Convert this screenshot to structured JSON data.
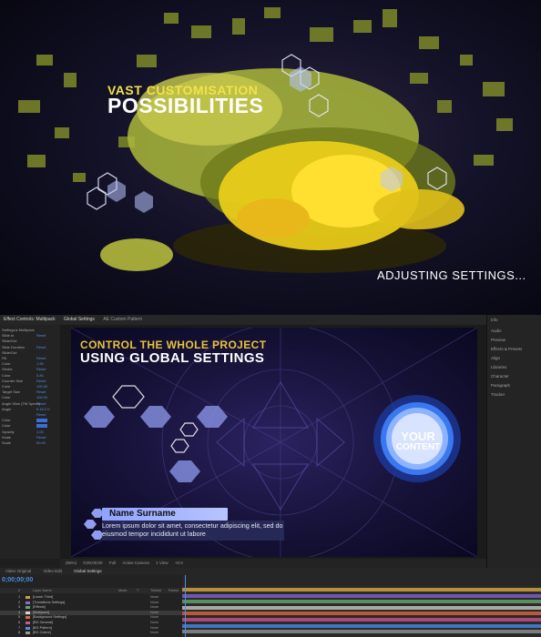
{
  "promo": {
    "line1": "VAST CUSTOMISATION",
    "line2": "POSSIBILITIES",
    "subtitle": "ADJUSTING SETTINGS..."
  },
  "effects_panel": {
    "tab": "Effect Controls: Multipack",
    "rows": [
      {
        "label": "Settings ▸ Multipack",
        "value": ""
      },
      {
        "label": "Slide In",
        "value": "Reset"
      },
      {
        "label": "Slide/Out",
        "value": ""
      },
      {
        "label": "Slide Duration",
        "value": "Reset"
      },
      {
        "label": "Slide/Out",
        "value": ""
      },
      {
        "label": "Fill",
        "value": "Reset"
      },
      {
        "label": "Color",
        "value": "1.85"
      },
      {
        "label": "Stroke",
        "value": "Reset"
      },
      {
        "label": "Color",
        "value": "3.80"
      },
      {
        "label": "Counter Size",
        "value": "Reset"
      },
      {
        "label": "Color",
        "value": "100.00"
      },
      {
        "label": "Target Size",
        "value": "Reset"
      },
      {
        "label": "Color",
        "value": "100.00"
      },
      {
        "label": "Angle Slice (TM Speed)",
        "value": "Reset"
      },
      {
        "label": "Angle",
        "value": "0:15.2.0"
      },
      {
        "label": "",
        "value": "Reset"
      },
      {
        "label": "Color",
        "value": "swatch"
      },
      {
        "label": "Color",
        "value": "swatch"
      },
      {
        "label": "Opacity",
        "value": "1.00"
      },
      {
        "label": "Scale",
        "value": "Reset"
      },
      {
        "label": "Scale",
        "value": "50.00"
      }
    ]
  },
  "viewer": {
    "tabs": [
      "Global Settings",
      "AE Custom Pattern"
    ],
    "controls": [
      "(50%)",
      "0;00;00;00",
      "Full",
      "Active Camera",
      "1 View",
      "+0.0"
    ],
    "composition": {
      "line1": "CONTROL THE WHOLE PROJECT",
      "line2": "USING GLOBAL SETTINGS",
      "name": "Name Surname",
      "body": "Lorem ipsum dolor sit amet, consectetur adipiscing elit, sed do eiusmod tempor incididunt ut labore",
      "badge_line1": "YOUR",
      "badge_line2": "CONTENT"
    }
  },
  "right_panels": [
    "Info",
    "Audio",
    "Preview",
    "Effects & Presets",
    "Align",
    "Libraries",
    "Character",
    "Paragraph",
    "Tracker"
  ],
  "timeline": {
    "tabs": [
      "Video Original",
      "Video Edit",
      "Global Settings"
    ],
    "timecode": "0;00;00;00",
    "header": [
      "#",
      "Layer Name",
      "Mode",
      "T",
      "TrkMat",
      "Parent"
    ],
    "layers": [
      {
        "num": "1",
        "name": "[Lower Third]",
        "mode": "None",
        "color": "#c9a23e"
      },
      {
        "num": "2",
        "name": "[Transitions Settings]",
        "mode": "None",
        "color": "#8a6ad6"
      },
      {
        "num": "3",
        "name": "[Effects]",
        "mode": "None",
        "color": "#6aa36a"
      },
      {
        "num": "4",
        "name": "[Multipack]",
        "mode": "None",
        "color": "#d6d6d6"
      },
      {
        "num": "5",
        "name": "[Background Settings]",
        "mode": "None",
        "color": "#d66a3e"
      },
      {
        "num": "6",
        "name": "[BG General]",
        "mode": "None",
        "color": "#c95a8c"
      },
      {
        "num": "7",
        "name": "[BG Pattern]",
        "mode": "None",
        "color": "#4f8ee2"
      },
      {
        "num": "8",
        "name": "[BG Colors]",
        "mode": "None",
        "color": "#9a9a9a"
      }
    ],
    "track_colors": [
      "#b58f3a",
      "#6f56b3",
      "#5a8f5a",
      "#a8a8a8",
      "#b85a34",
      "#a84a78",
      "#4275c0",
      "#7d7d7d"
    ]
  }
}
